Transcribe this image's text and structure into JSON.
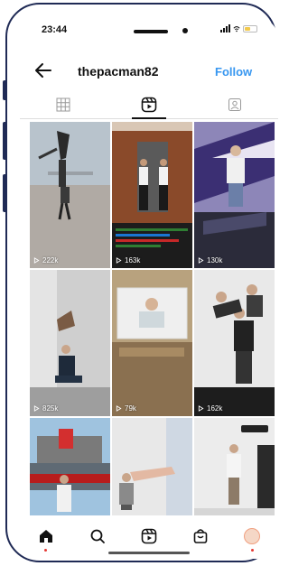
{
  "status": {
    "time": "23:44"
  },
  "header": {
    "username": "thepacman82",
    "follow_label": "Follow"
  },
  "tabs": [
    {
      "icon": "grid-icon",
      "active": false
    },
    {
      "icon": "reels-icon",
      "active": true
    },
    {
      "icon": "tagged-icon",
      "active": false
    }
  ],
  "reels": [
    {
      "views": "222k"
    },
    {
      "views": "163k"
    },
    {
      "views": "130k"
    },
    {
      "views": "825k"
    },
    {
      "views": "79k"
    },
    {
      "views": "162k"
    },
    {
      "views": ""
    },
    {
      "views": ""
    },
    {
      "views": ""
    }
  ],
  "nav": [
    "home-icon",
    "search-icon",
    "reels-icon",
    "shop-icon",
    "profile-avatar"
  ],
  "colors": {
    "accent": "#3897f0",
    "frame": "#1f2a55",
    "notification": "#e53935"
  }
}
